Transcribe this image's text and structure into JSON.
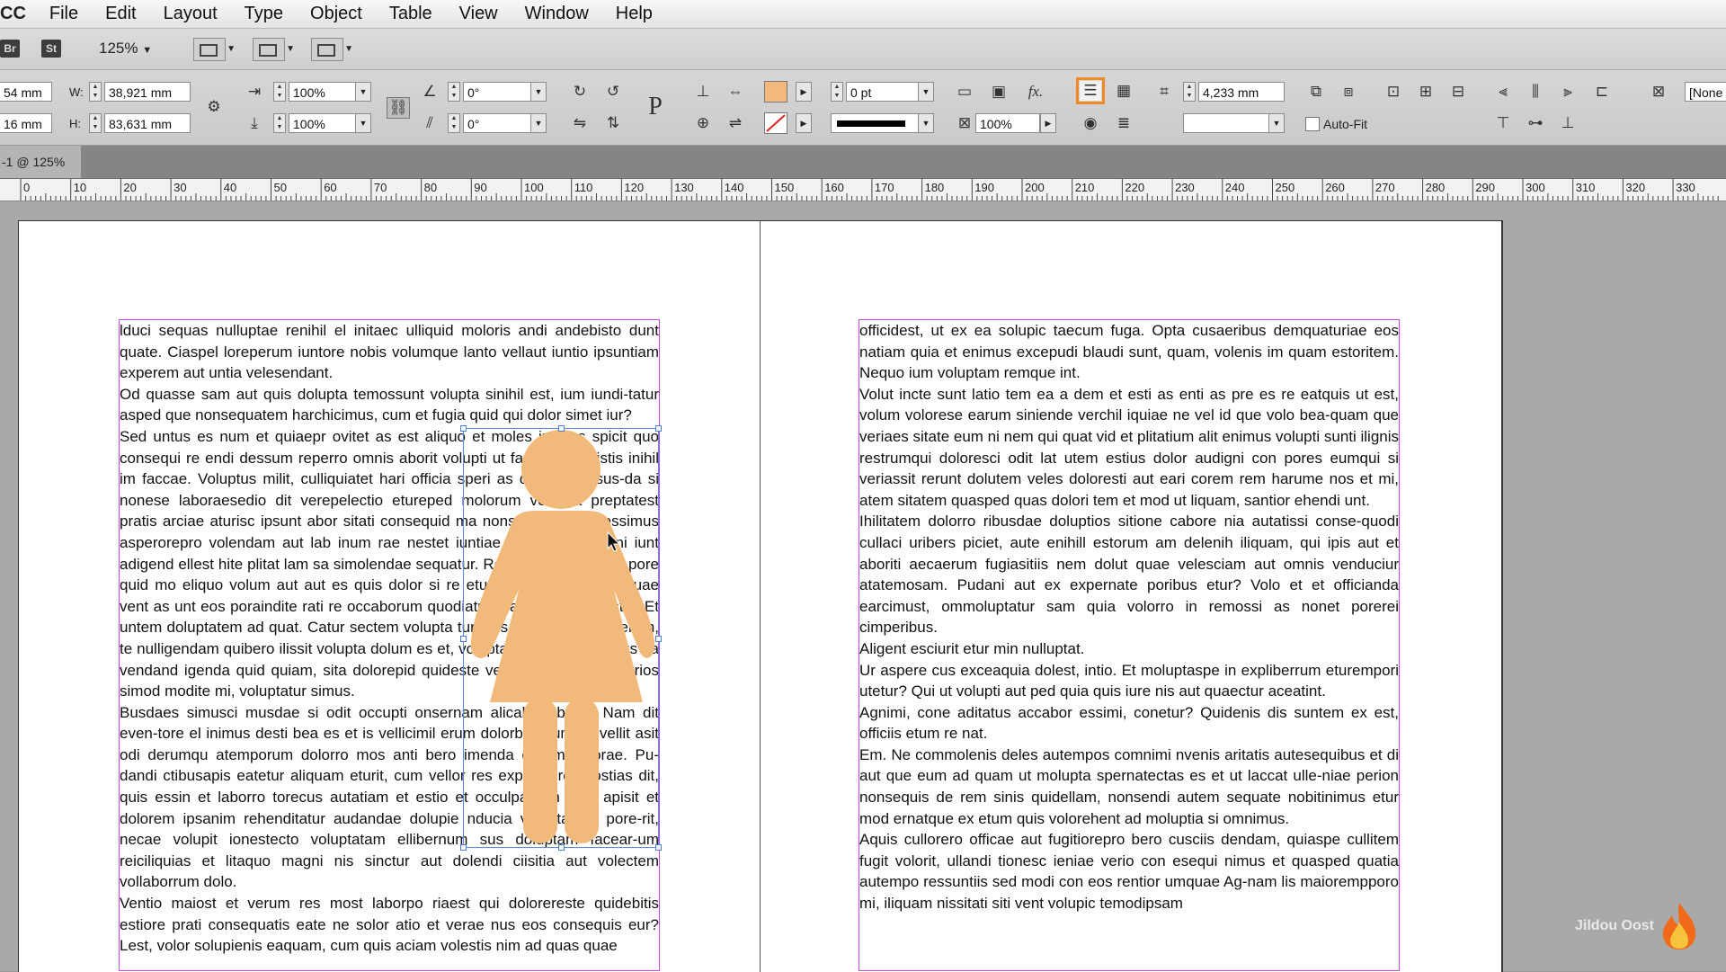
{
  "app": {
    "name": "CC"
  },
  "menu": [
    "File",
    "Edit",
    "Layout",
    "Type",
    "Object",
    "Table",
    "View",
    "Window",
    "Help"
  ],
  "appbar": {
    "bridge_badge": "Br",
    "stock_badge": "St",
    "zoom": "125%"
  },
  "control": {
    "x": "54 mm",
    "y": "16 mm",
    "w_label": "W:",
    "h_label": "H:",
    "w": "38,921 mm",
    "h": "83,631 mm",
    "scale_x": "100%",
    "scale_y": "100%",
    "rotate": "0°",
    "shear": "0°",
    "stroke_weight": "0 pt",
    "opacity": "100%",
    "gap": "4,233 mm",
    "autofit_label": "Auto-Fit",
    "style_none": "[None"
  },
  "colors": {
    "fill": "#f1b97a",
    "highlight": "#f08a24",
    "frame": "#c44ee0",
    "selection": "#4a7fd4"
  },
  "document_tab": "-1 @ 125%",
  "ruler": {
    "labels": [
      "0",
      "10",
      "20",
      "30",
      "40",
      "50",
      "60",
      "70",
      "80",
      "90",
      "100",
      "110",
      "120",
      "130",
      "140",
      "150",
      "160",
      "170",
      "180",
      "190",
      "200",
      "210",
      "220",
      "230",
      "240",
      "250",
      "260",
      "270",
      "280",
      "290",
      "300",
      "310",
      "320",
      "330"
    ]
  },
  "left_text": [
    "lduci sequas nulluptae renihil el initaec ulliquid moloris andi andebisto dunt quate. Ciaspel loreperum iuntore nobis volumque lanto vellaut iuntio ipsuntiam experem aut untia velesendant.",
    "Od quasse sam aut quis dolupta temossunt volupta sinihil est, ium iundi-tatur asped que nonsequatem harchicimus, cum et fugia quid qui dolor simet iur?",
    "Sed untus es num et quiaepr ovitet as est aliquo et moles ium es spicit quo consequi re endi dessum reperro omnis aborit volupti ut facerum endistis inihil im faccae. Voluptus milit, culliquiatet hari officia speri as doluptati ipsus-da si nonese laboraesedio dit verepelectio etureped molorum velestia preptatest pratis arciae aturisc ipsunt abor sitati consequid ma nonsequande poressimus asperorepro volendam aut lab inum rae nestet iuntiae. Ihilisti tem hil ini iunt adigend ellest hite plitat lam sa simolendae sequatur. Re, officatas iust, sin pore quid mo eliquo volum aut aut es quis dolor si re etur sitas esciisi tatur, quae vent as unt eos poraindite rati re occaborum quodiatur. Parciumenda nestio. Et untem doluptatem ad quat. Catur sectem volupta tur odis as derferum, exerum, te nulligendam quibero ilissit volupta dolum es et, voluptatque nimendae sus ea vendand igenda quid quiam, sita dolorepid quideste venite porum eat aperios simod modite mi, voluptatur simus.",
    "Busdaes simusci musdae si odit occupti onsernam alicab illaborio. Nam dit even-tore el inimus desti bea es et is vellicimil erum dolorbus sum int vellit asit odi derumqu atemporum dolorro mos anti bero imenda derum volorae. Pu-dandi ctibusapis eatetur aliquam eturit, cum vellor res explabo rempostias dit, quis essin et laborro torecus autatiam et estio et occulpa con sunt apisit et dolorem ipsanim rehenditatur audandae dolupie nducia volupta del pore-rit, necae volupit ionestecto voluptatam ellibernum sus doluptam facear-um reiciliquias et litaquo magni nis sinctur aut dolendi ciisitia aut volectem vollaborrum dolo.",
    "Ventio maiost et verum res most laborpo riaest qui dolorereste quidebitis estiore prati consequatis eate ne solor atio et verae nus eos consequis eur? Lest, volor solupienis eaquam, cum quis aciam volestis nim ad quas quae"
  ],
  "right_text": [
    "officidest, ut ex ea solupic taecum fuga. Opta cusaeribus demquaturiae eos natiam quia et enimus excepudi blaudi sunt, quam, volenis im quam estoritem. Nequo ium voluptam remque int.",
    "Volut incte sunt latio tem ea a dem et esti as enti as pre es re eatquis ut est, volum volorese earum siniende verchil iquiae ne vel id que volo bea-quam que veriaes sitate eum ni nem qui quat vid et plitatium alit enimus volupti sunti ilignis restrumqui doloresci odit lat utem estius dolor audigni con pores eumqui si veriassit rerunt dolutem veles doloresti aut eari corem rem harume nos et mi, atem sitatem quasped quas dolori tem et mod ut liquam, santior ehendi unt.",
    "Ihilitatem dolorro ribusdae doluptios sitione cabore nia autatissi conse-quodi cullaci uribers piciet, aute enihill estorum am delenih iliquam, qui ipis aut et aboriti aecaerum fugiasitiis nem dolut quae velesciam aut omnis venduciur atatemosam. Pudani aut ex expernate poribus etur? Volo et et officianda earcimust, ommoluptatur sam quia volorro in remossi as nonet porerei cimperibus.",
    "Aligent esciurit etur min nulluptat.",
    "Ur aspere cus exceaquia dolest, intio. Et moluptaspe in expliberrum eturempori utetur? Qui ut volupti aut ped quia quis iure nis aut quaectur aceatint.",
    "Agnimi, cone aditatus accabor essimi, conetur? Quidenis dis suntem ex est, officiis etum re nat.",
    "Em. Ne commolenis deles autempos comnimi nvenis aritatis autesequibus et di aut que eum ad quam ut molupta spernatectas es et ut laccat ulle-niae perion nonsequis de rem sinis quidellam, nonsendi autem sequate nobitinimus etur mod ernatque ex etum quis volorehent ad moluptia si omnimus.",
    "Aquis cullorero officae aut fugitiorepro bero cusciis dendam, quiaspe cullitem fugit volorit, ullandi tionesc ieniae verio con esequi nimus et quasped quatia autempo ressuntiis sed modi con eos rentior umquae Ag-nam lis maiorempporo mi, iliquam nissitati siti vent volupic temodipsam"
  ],
  "watermark": "Jildou Oost"
}
